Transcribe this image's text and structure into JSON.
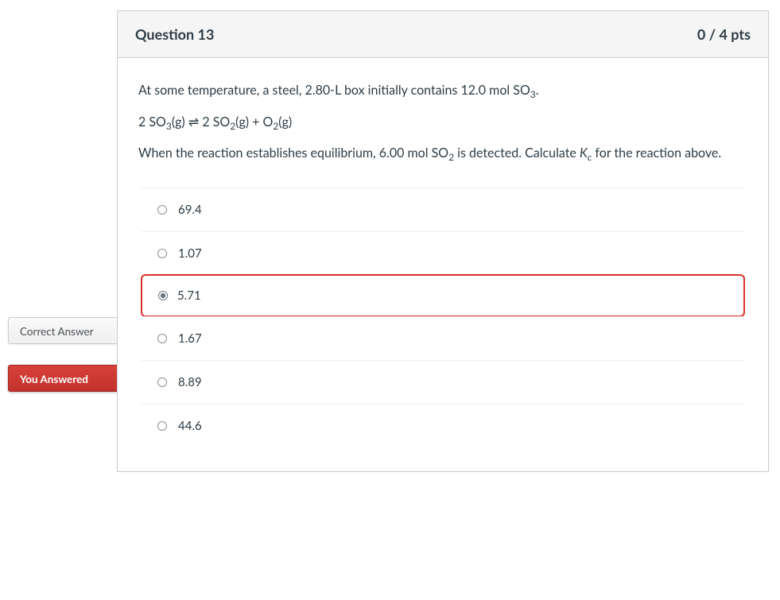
{
  "header": {
    "title": "Question 13",
    "points": "0 / 4 pts"
  },
  "question": {
    "line1_pre": "At some temperature, a steel, 2.80-L box initially contains 12.0 mol SO",
    "line1_sub": "3",
    "line1_post": ".",
    "eq_a": "2 SO",
    "eq_a_sub": "3",
    "eq_a_phase": "(g)",
    "eq_arrow": " ⇌ ",
    "eq_b": " 2 SO",
    "eq_b_sub": "2",
    "eq_b_phase": "(g)  +  O",
    "eq_c_sub": "2",
    "eq_c_phase": "(g)",
    "line3_pre": "When the reaction establishes equilibrium, 6.00 mol SO",
    "line3_sub": "2",
    "line3_post": " is detected.  Calculate ",
    "kc_k": "K",
    "kc_sub": "c",
    "line3_end": " for the reaction above."
  },
  "answers": [
    {
      "label": "69.4",
      "state": "none"
    },
    {
      "label": "1.07",
      "state": "correct"
    },
    {
      "label": "5.71",
      "state": "user_wrong"
    },
    {
      "label": "1.67",
      "state": "none"
    },
    {
      "label": "8.89",
      "state": "none"
    },
    {
      "label": "44.6",
      "state": "none"
    }
  ],
  "flags": {
    "correct": "Correct Answer",
    "you_answered": "You Answered"
  }
}
